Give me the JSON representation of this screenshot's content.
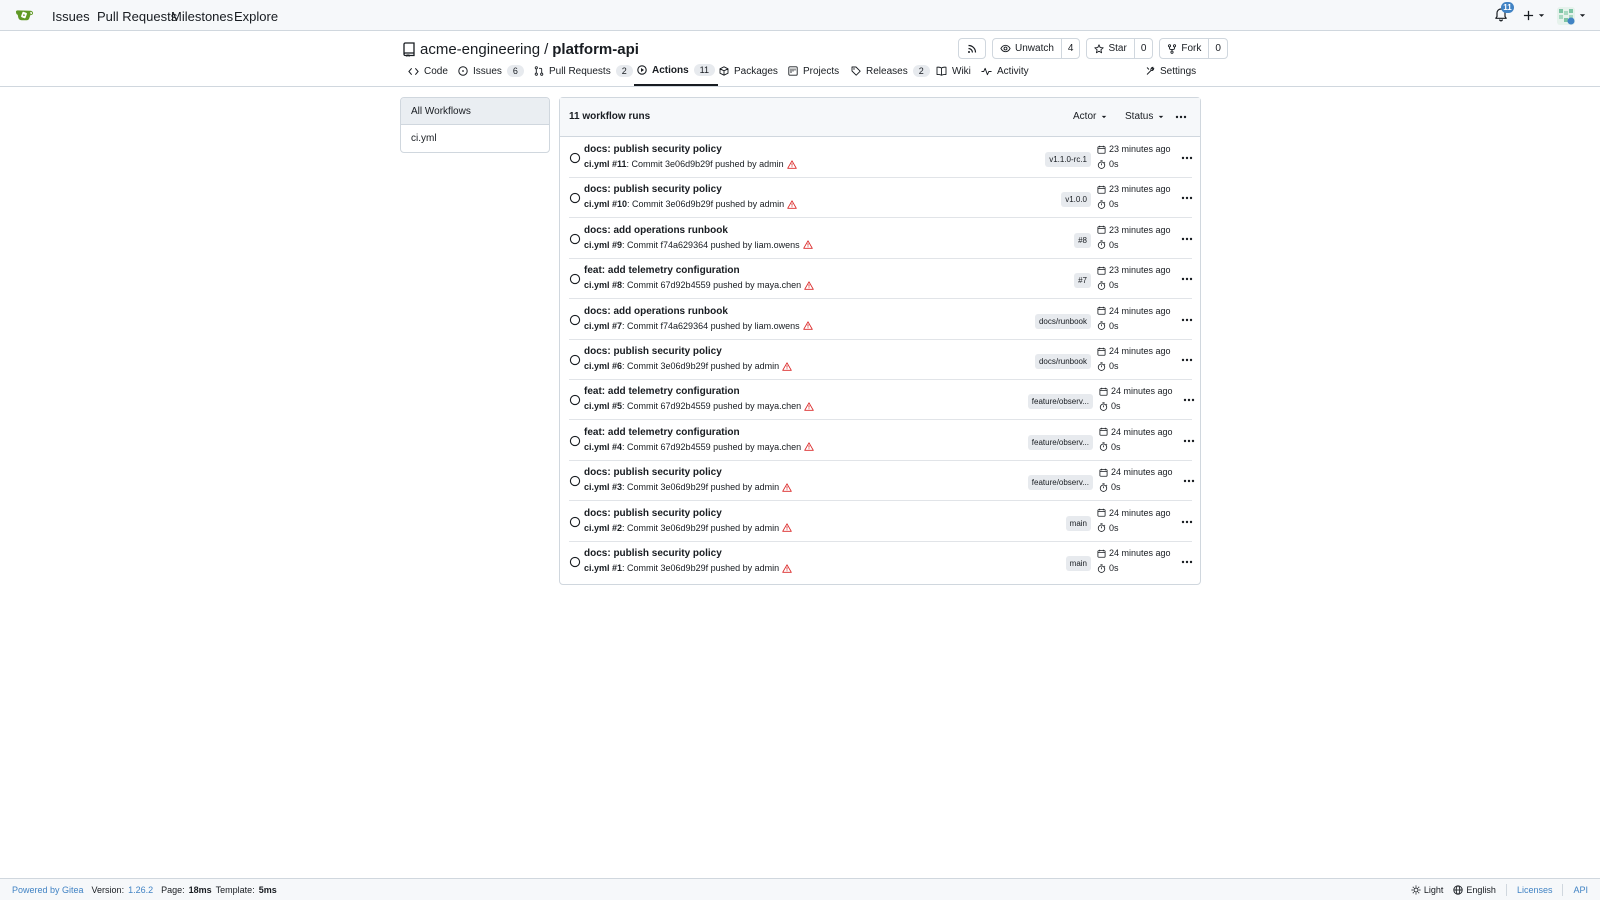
{
  "nav": {
    "links": [
      "Issues",
      "Pull Requests",
      "Milestones",
      "Explore"
    ],
    "notification_count": "11"
  },
  "repo": {
    "owner": "acme-engineering",
    "separator": "/",
    "name": "platform-api",
    "watch_label": "Unwatch",
    "watch_count": "4",
    "star_label": "Star",
    "star_count": "0",
    "fork_label": "Fork",
    "fork_count": "0"
  },
  "tabs": {
    "code": "Code",
    "issues": "Issues",
    "issues_count": "6",
    "pulls": "Pull Requests",
    "pulls_count": "2",
    "actions": "Actions",
    "actions_count": "11",
    "packages": "Packages",
    "projects": "Projects",
    "releases": "Releases",
    "releases_count": "2",
    "wiki": "Wiki",
    "activity": "Activity",
    "settings": "Settings"
  },
  "sidebar": {
    "items": [
      "All Workflows",
      "ci.yml"
    ]
  },
  "runs_header": {
    "count_label": "11 workflow runs",
    "actor": "Actor",
    "status": "Status"
  },
  "runs": [
    {
      "title": "docs: publish security policy",
      "workflow": "ci.yml #11",
      "commit_text": ": Commit 3e06d9b29f pushed by admin",
      "branch": "v1.1.0-rc.1",
      "time": "23 minutes ago",
      "duration": "0s"
    },
    {
      "title": "docs: publish security policy",
      "workflow": "ci.yml #10",
      "commit_text": ": Commit 3e06d9b29f pushed by admin",
      "branch": "v1.0.0",
      "time": "23 minutes ago",
      "duration": "0s"
    },
    {
      "title": "docs: add operations runbook",
      "workflow": "ci.yml #9",
      "commit_text": ": Commit f74a629364 pushed by liam.owens",
      "branch": "#8",
      "time": "23 minutes ago",
      "duration": "0s"
    },
    {
      "title": "feat: add telemetry configuration",
      "workflow": "ci.yml #8",
      "commit_text": ": Commit 67d92b4559 pushed by maya.chen",
      "branch": "#7",
      "time": "23 minutes ago",
      "duration": "0s"
    },
    {
      "title": "docs: add operations runbook",
      "workflow": "ci.yml #7",
      "commit_text": ": Commit f74a629364 pushed by liam.owens",
      "branch": "docs/runbook",
      "time": "24 minutes ago",
      "duration": "0s"
    },
    {
      "title": "docs: publish security policy",
      "workflow": "ci.yml #6",
      "commit_text": ": Commit 3e06d9b29f pushed by admin",
      "branch": "docs/runbook",
      "time": "24 minutes ago",
      "duration": "0s"
    },
    {
      "title": "feat: add telemetry configuration",
      "workflow": "ci.yml #5",
      "commit_text": ": Commit 67d92b4559 pushed by maya.chen",
      "branch": "feature/observ...",
      "time": "24 minutes ago",
      "duration": "0s"
    },
    {
      "title": "feat: add telemetry configuration",
      "workflow": "ci.yml #4",
      "commit_text": ": Commit 67d92b4559 pushed by maya.chen",
      "branch": "feature/observ...",
      "time": "24 minutes ago",
      "duration": "0s"
    },
    {
      "title": "docs: publish security policy",
      "workflow": "ci.yml #3",
      "commit_text": ": Commit 3e06d9b29f pushed by admin",
      "branch": "feature/observ...",
      "time": "24 minutes ago",
      "duration": "0s"
    },
    {
      "title": "docs: publish security policy",
      "workflow": "ci.yml #2",
      "commit_text": ": Commit 3e06d9b29f pushed by admin",
      "branch": "main",
      "time": "24 minutes ago",
      "duration": "0s"
    },
    {
      "title": "docs: publish security policy",
      "workflow": "ci.yml #1",
      "commit_text": ": Commit 3e06d9b29f pushed by admin",
      "branch": "main",
      "time": "24 minutes ago",
      "duration": "0s"
    }
  ],
  "footer": {
    "powered_by": "Powered by Gitea",
    "version_label": "Version:",
    "version": "1.26.2",
    "page_label": "Page:",
    "page_time": "18ms",
    "template_label": "Template:",
    "template_time": "5ms",
    "theme": "Light",
    "language": "English",
    "licenses": "Licenses",
    "api": "API"
  },
  "colors": {
    "link": "#4183c4",
    "warning": "#db2828",
    "border": "#d0d7de"
  }
}
